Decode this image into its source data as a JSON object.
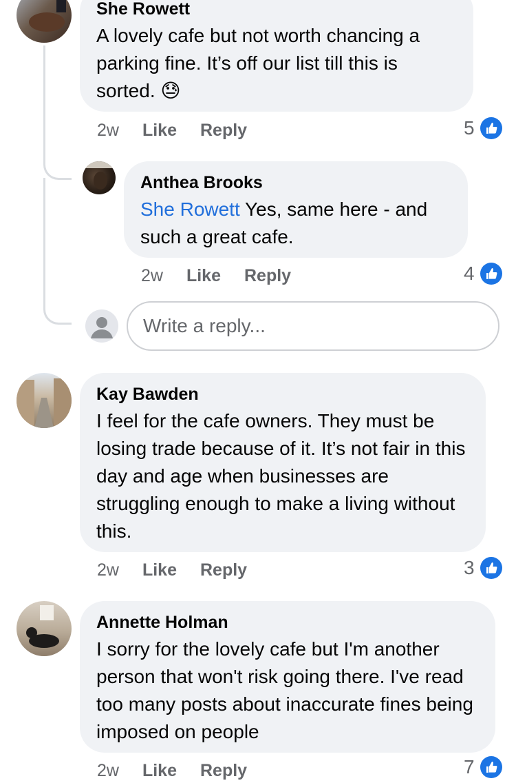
{
  "comments": [
    {
      "author": "She Rowett",
      "text": "A lovely cafe but not worth chancing a parking fine. It’s off our list till this is sorted.",
      "emoji": "😓",
      "time": "2w",
      "like_label": "Like",
      "reply_label": "Reply",
      "reaction_count": "5"
    },
    {
      "author": "Anthea Brooks",
      "mention": "She Rowett",
      "text": "Yes, same here - and such a great cafe.",
      "time": "2w",
      "like_label": "Like",
      "reply_label": "Reply",
      "reaction_count": "4"
    },
    {
      "author": "Kay Bawden",
      "text": "I feel for the cafe owners. They must be losing trade because of it. It’s not fair in this day and age when businesses are struggling enough to make a living without this.",
      "time": "2w",
      "like_label": "Like",
      "reply_label": "Reply",
      "reaction_count": "3"
    },
    {
      "author": "Annette Holman",
      "text": "I sorry for the lovely cafe but I'm another person that won't risk going there. I've read too many posts about inaccurate fines being imposed on people",
      "time": "2w",
      "like_label": "Like",
      "reply_label": "Reply",
      "reaction_count": "7"
    }
  ],
  "reply_box": {
    "placeholder": "Write a reply..."
  },
  "colors": {
    "accent": "#1b74e4",
    "bubble": "#f0f2f5",
    "meta": "#65676b",
    "mention": "#216fdb"
  },
  "icons": {
    "reaction": "thumbs-up-icon",
    "default_avatar": "person-icon"
  }
}
